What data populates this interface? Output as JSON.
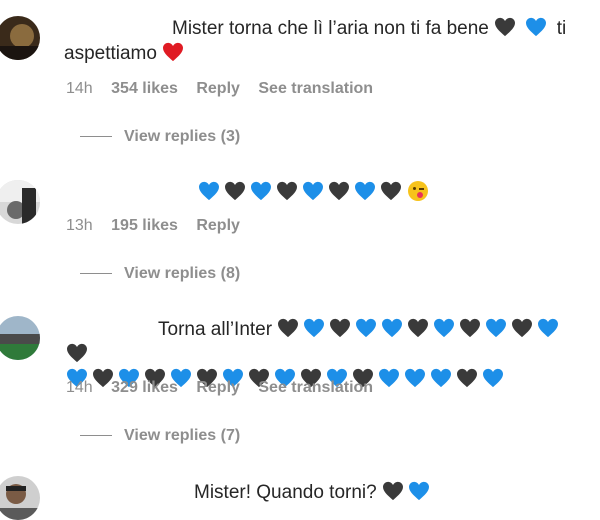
{
  "comments": [
    {
      "text": "Mister torna che lì l’aria non ti fa bene",
      "text_tail": "ti",
      "text_line2": "aspettiamo",
      "time": "14h",
      "likes": "354 likes",
      "reply": "Reply",
      "translation": "See translation",
      "view_replies": "View replies (3)"
    },
    {
      "time": "13h",
      "likes": "195 likes",
      "reply": "Reply",
      "view_replies": "View replies (8)"
    },
    {
      "text": "Torna all’Inter",
      "time": "14h",
      "likes": "329 likes",
      "reply": "Reply",
      "translation": "See translation",
      "view_replies": "View replies (7)"
    },
    {
      "text": "Mister! Quando torni?"
    }
  ],
  "colors": {
    "blue_heart": "#1d8fe8",
    "black_heart": "#3a3a3a",
    "red_heart": "#e01b24",
    "meta_text": "#8e8e8e"
  }
}
